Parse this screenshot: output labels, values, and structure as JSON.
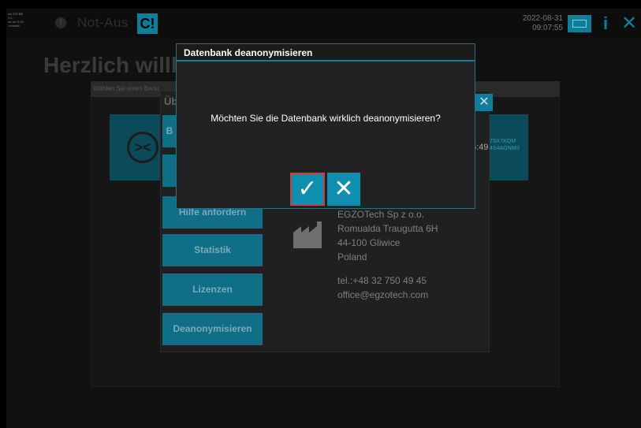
{
  "topbar": {
    "sysinfo": "ws 220 BB\n1.1\nes ver 0.00\n-unused",
    "warning_icon": "warning-icon",
    "emergency_label": "Not-Aus",
    "logo_glyph": "C!",
    "date": "2022-08-31",
    "time": "09:07:55",
    "keyboard_icon": "keyboard-icon",
    "info_glyph": "i",
    "close_glyph": "✕"
  },
  "page": {
    "welcome_title": "Herzlich willk",
    "user_prompt": "Wählen Sie einen Benu",
    "right_tile_code": "7SX7KQM\n4S4AGNMS",
    "time_partial": "5:49"
  },
  "about": {
    "title_partial": "Üb",
    "close_glyph": "✕",
    "buttons": {
      "top1": "B",
      "help": "Hilfe anfordern",
      "stat": "Statistik",
      "lic": "Lizenzen",
      "deanon": "Deanonymisieren"
    },
    "company": {
      "name_partial": "EGZOTech Sp z o.o.",
      "street": "Romualda Traugutta 6H",
      "city": "44-100 Gliwice",
      "country": "Poland",
      "tel": "tel.:+48 32 750 49 45",
      "email": "office@egzotech.com"
    }
  },
  "modal": {
    "title": "Datenbank deanonymisieren",
    "message": "Möchten Sie die Datenbank wirklich deanonymisieren?",
    "confirm_glyph": "✓",
    "cancel_glyph": "✕"
  },
  "colors": {
    "accent": "#0f8fb0",
    "danger_outline": "#c94040",
    "background": "#111111"
  }
}
